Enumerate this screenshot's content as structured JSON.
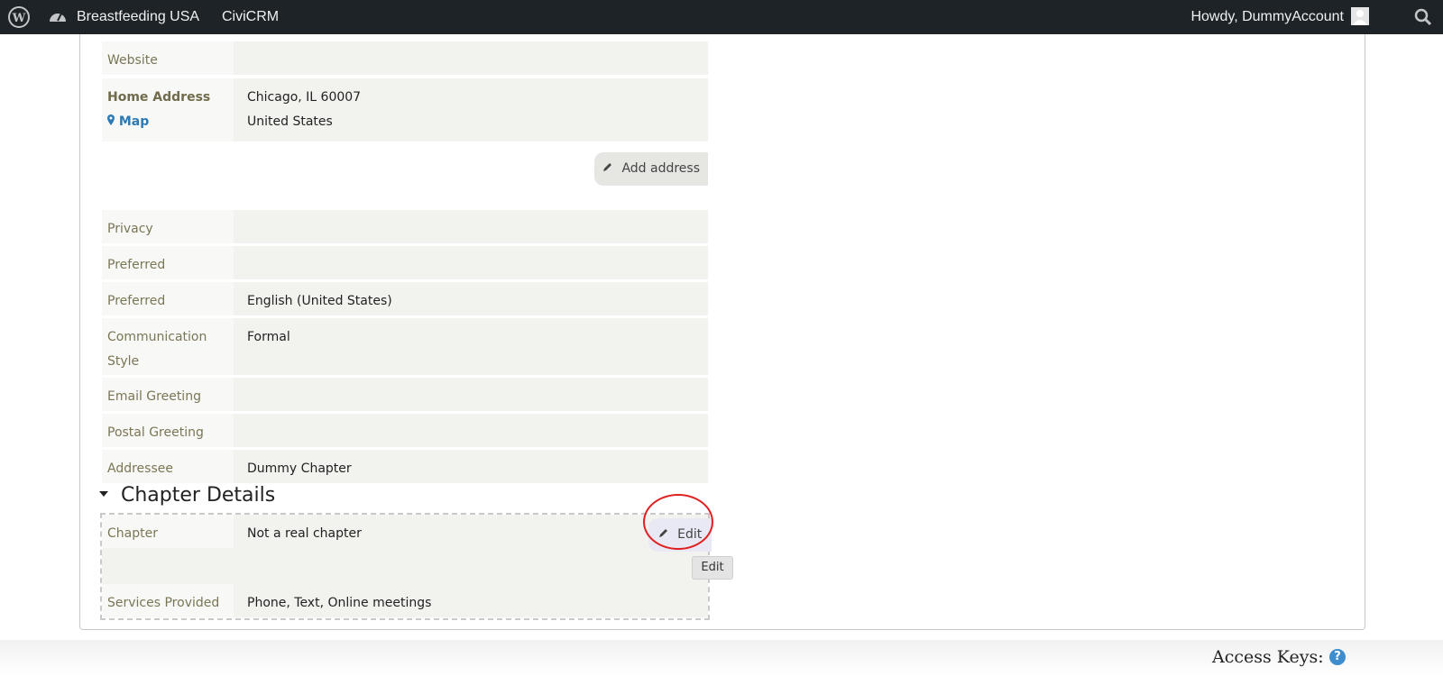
{
  "adminbar": {
    "site_name": "Breastfeeding USA",
    "civicrm": "CiviCRM",
    "howdy": "Howdy, DummyAccount"
  },
  "contact": {
    "website_label": "Website",
    "website_value": "",
    "home_address_label": "Home Address",
    "map_label": "Map",
    "address_line1": "Chicago, IL 60007",
    "address_line2": "United States",
    "add_address_label": "Add address",
    "fields": [
      {
        "label": "Privacy",
        "value": ""
      },
      {
        "label": "Preferred Method(s)",
        "value": ""
      },
      {
        "label": "Preferred Language",
        "value": "English (United States)"
      },
      {
        "label": "Communication Style",
        "value": "Formal"
      },
      {
        "label": "Email Greeting",
        "value": ""
      },
      {
        "label": "Postal Greeting",
        "value": ""
      },
      {
        "label": "Addressee",
        "value": "Dummy Chapter"
      }
    ]
  },
  "chapter": {
    "section_title": "Chapter Details",
    "edit_label": "Edit",
    "tooltip": "Edit",
    "fields": [
      {
        "label": "Chapter Description",
        "value": "Not a real chapter"
      },
      {
        "label": "Services Provided",
        "value": "Phone, Text, Online meetings"
      }
    ]
  },
  "footer": {
    "access_keys": "Access Keys:",
    "help_glyph": "?"
  },
  "icons": {
    "wordpress": "wordpress-logo-icon",
    "dashboard": "dashboard-icon",
    "avatar": "avatar-icon",
    "search": "search-icon",
    "map_marker": "map-marker-icon",
    "pencil": "pencil-icon"
  }
}
